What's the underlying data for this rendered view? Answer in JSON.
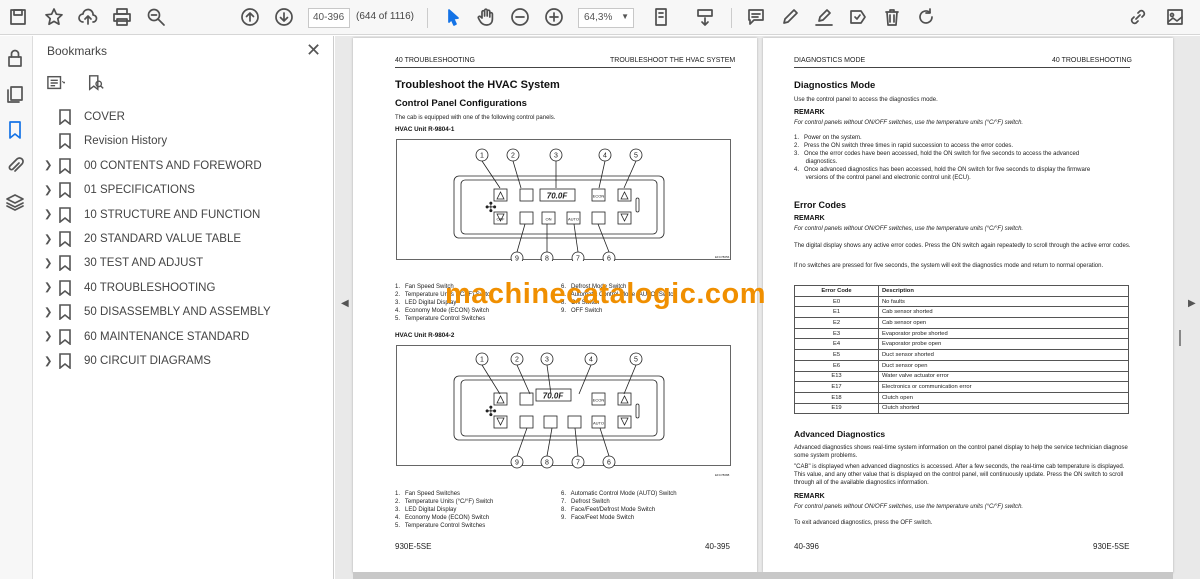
{
  "toolbar": {
    "page_value": "40-396",
    "page_count": "(644 of 1116)",
    "zoom": "64,3%"
  },
  "bookmarks": {
    "title": "Bookmarks",
    "items": [
      {
        "label": "COVER",
        "expandable": false
      },
      {
        "label": "Revision History",
        "expandable": false
      },
      {
        "label": "00 CONTENTS AND FOREWORD",
        "expandable": true
      },
      {
        "label": "01 SPECIFICATIONS",
        "expandable": true
      },
      {
        "label": "10 STRUCTURE AND FUNCTION",
        "expandable": true
      },
      {
        "label": "20 STANDARD VALUE TABLE",
        "expandable": true
      },
      {
        "label": "30 TEST AND ADJUST",
        "expandable": true
      },
      {
        "label": "40 TROUBLESHOOTING",
        "expandable": true
      },
      {
        "label": "50 DISASSEMBLY AND ASSEMBLY",
        "expandable": true
      },
      {
        "label": "60 MAINTENANCE STANDARD",
        "expandable": true
      },
      {
        "label": "90 CIRCUIT DIAGRAMS",
        "expandable": true
      }
    ]
  },
  "left_page": {
    "header_left": "40 TROUBLESHOOTING",
    "header_right": "TROUBLESHOOT THE HVAC SYSTEM",
    "title": "Troubleshoot the HVAC System",
    "subtitle": "Control Panel Configurations",
    "intro": "The cab is equipped with one of the following control panels.",
    "unit1": "HVAC Unit R-9804-1",
    "unit2": "HVAC Unit R-9804-2",
    "display1": "70.0F",
    "display2": "70.0F",
    "fig1_code": "EFC78056",
    "fig2_code": "EFC78088",
    "legend1_left": [
      "1.   Fan Speed Switch",
      "2.   Temperature Units (°C/°F) Switch",
      "3.   LED Digital Display",
      "4.   Economy Mode (ECON) Switch",
      "5.   Temperature Control Switches"
    ],
    "legend1_right": [
      "6.   Defrost Mode Switch",
      "7.   Automatic Control Mode (AUTO) Switch",
      "8.   ON Switch",
      "9.   OFF Switch"
    ],
    "legend2_left": [
      "1.   Fan Speed Switches",
      "2.   Temperature Units (°C/°F) Switch",
      "3.   LED Digital Display",
      "4.   Economy Mode (ECON) Switch",
      "5.   Temperature Control Switches"
    ],
    "legend2_right": [
      "6.   Automatic Control Mode (AUTO) Switch",
      "7.   Defrost Switch",
      "8.   Face/Feet/Defrost Mode Switch",
      "9.   Face/Feet Mode Switch"
    ],
    "btn_off": "OFF",
    "btn_on": "ON",
    "btn_auto": "AUTO",
    "btn_econ": "ECON",
    "footer_left": "930E-5SE",
    "footer_right": "40-395"
  },
  "right_page": {
    "header_left": "DIAGNOSTICS MODE",
    "header_right": "40 TROUBLESHOOTING",
    "title": "Diagnostics Mode",
    "intro": "Use the control panel to access the diagnostics mode.",
    "remark_label": "REMARK",
    "remark1": "For control panels without ON/OFF switches, use the temperature units (°C/°F) switch.",
    "steps": [
      "1.   Power on the system.",
      "2.   Press the ON switch three times in rapid succession to access the error codes.",
      "3.   Once the error codes have been accessed, hold the ON switch for five seconds to access the advanced",
      "       diagnostics.",
      "4.   Once advanced diagnostics has been accessed, hold the ON switch for five seconds to display the firmware",
      "       versions of the control panel and electronic control unit (ECU)."
    ],
    "error_title": "Error Codes",
    "remark2": "For control panels without ON/OFF switches, use the temperature units (°C/°F) switch.",
    "error_p1": "The digital display shows any active error codes. Press the ON switch again repeatedly to scroll through the active error codes.",
    "error_p2": "If no switches are pressed for five seconds, the system will exit the diagnostics mode and return to normal operation.",
    "table_head": [
      "Error Code",
      "Description"
    ],
    "table_rows": [
      [
        "E0",
        "No faults"
      ],
      [
        "E1",
        "Cab sensor shorted"
      ],
      [
        "E2",
        "Cab sensor open"
      ],
      [
        "E3",
        "Evaporator probe shorted"
      ],
      [
        "E4",
        "Evaporator probe open"
      ],
      [
        "E5",
        "Duct sensor shorted"
      ],
      [
        "E6",
        "Duct sensor open"
      ],
      [
        "E13",
        "Water valve actuator error"
      ],
      [
        "E17",
        "Electronics or communication error"
      ],
      [
        "E18",
        "Clutch open"
      ],
      [
        "E19",
        "Clutch shorted"
      ]
    ],
    "adv_title": "Advanced Diagnostics",
    "adv_p1": "Advanced diagnostics shows real-time system information on the control panel display to help the service technician diagnose some system problems.",
    "adv_p2": "\"CAB\" is displayed when advanced diagnostics is accessed. After a few seconds, the real-time cab temperature is displayed. This value, and any other value that is displayed on the control panel, will continuously update. Press the ON switch to scroll through all of the available diagnostics information.",
    "remark3": "For control panels without ON/OFF switches, use the temperature units (°C/°F) switch.",
    "exit_text": "To exit advanced diagnostics, press the OFF switch.",
    "footer_left": "40-396",
    "footer_right": "930E-5SE"
  },
  "watermark": "machinecatalogic.com"
}
